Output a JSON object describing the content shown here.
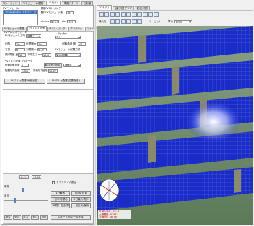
{
  "app": {
    "left_tabs": [
      "ロケーション",
      "PVモジュール/基礎",
      "3Dモデル",
      "構成パターン",
      "日射量"
    ],
    "right_tabs": [
      "3Dモデル",
      "反射光性グラフ",
      "影/反射図"
    ]
  },
  "module_panel": {
    "label": "PVモジュール",
    "selected_item": "HIT-N240SE10 フタバソーラー",
    "string_header": "想定PVストリング",
    "series_label": "直列PVモジュール数",
    "series_value": "15",
    "vpmax_label": "Vpmax",
    "vpmax_value": "457.5",
    "voc_label": "Voc",
    "voc_value": "554"
  },
  "sub_tabs": [
    "PVモジュール配置",
    "PVアレイ配置",
    "PVストリング",
    "プロパティ",
    "マテリアル"
  ],
  "array_panel": {
    "section_label": "PVアレイパラメータ",
    "orientation_label": "PVモジュール方向",
    "orientation_value": "縦置き",
    "tracker_label": "トラッカー",
    "tracker_value": "なし",
    "columns_label": "列数",
    "columns_value": "10",
    "rows_label": "行数",
    "rows_value": "6",
    "col_gap_label": "列間隔 m",
    "col_gap_value": "0.02",
    "row_gap_label": "行間隔 m",
    "row_gap_value": "10",
    "tilt_label": "傾斜角度 度",
    "tilt_value": "10",
    "height_label": "下端高さ mm",
    "height_value": "1000",
    "movable_label": "可動角度 度",
    "movable_value": "45",
    "placement_label": "PVモジュール配置方式",
    "placement_value": "架台(設置)",
    "array_section": "PVアレイ配置パラメータ",
    "plane_label": "配置平面角度",
    "plane_value": "0",
    "shadow_button": "影/反射の計算",
    "yield_button": "発電量",
    "dist_x_label": "配置方向距離",
    "dist_x_value": "1000",
    "dist_y_label": "前後方向距離",
    "dist_y_value": "5587",
    "place_button": "PVアレイ配置(地形追従)",
    "place_button2": "PVアレイ配置(位置指定)"
  },
  "time_panel": {
    "date": "03/21",
    "time": "13:10",
    "track_label": "トラッキング追従",
    "hour_label": "時刻",
    "day_label": "月日",
    "buttons": [
      "再生",
      "停止",
      "戻る",
      "進む",
      "日付"
    ],
    "right_buttons": [
      "1日最大",
      "前回の計算",
      "1日平均/表示",
      "1日最大/表示",
      "レポート",
      "1時間一括計算",
      "一括出力/保存",
      "レポート作成/一括計算"
    ]
  },
  "toolbar": {
    "mode_label": "オービット",
    "zoom_label": "寄る",
    "zoom_value": "1000",
    "angle_label": "最大化"
  },
  "overlay": {
    "line1": "日時 03/21 13:10",
    "line2": "太陽高度 47.62°",
    "line3": "太陽方位 38.78°"
  }
}
